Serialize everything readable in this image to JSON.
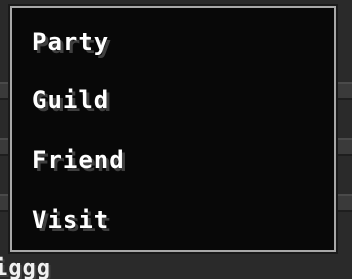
{
  "menu": {
    "items": [
      {
        "label": "Party"
      },
      {
        "label": "Guild"
      },
      {
        "label": "Friend"
      },
      {
        "label": "Visit"
      }
    ]
  },
  "background": {
    "partial_name": "iggg"
  },
  "colors": {
    "menu_background": "#080808",
    "menu_border": "#a8a8a8",
    "text": "#ffffff",
    "text_shadow": "#3f3f3f"
  }
}
